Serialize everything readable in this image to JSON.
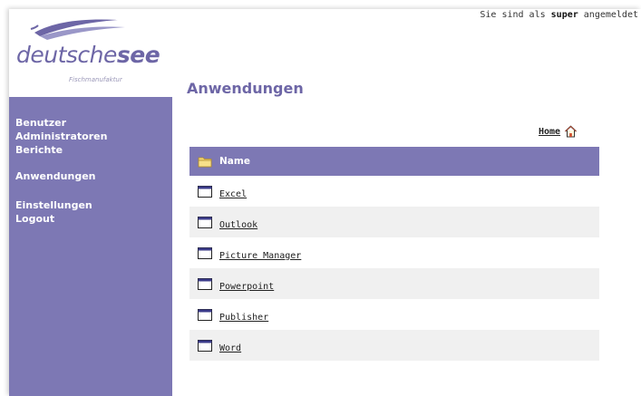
{
  "brand": {
    "name_light": "deutsche",
    "name_bold": "see",
    "tagline": "Fischmanufaktur"
  },
  "header": {
    "login_prefix": "Sie sind als ",
    "login_user": "super",
    "login_suffix": " angemeldet"
  },
  "sidebar": {
    "items": [
      {
        "label": "Benutzer"
      },
      {
        "label": "Administratoren"
      },
      {
        "label": "Berichte"
      },
      {
        "label": "Anwendungen"
      },
      {
        "label": "Einstellungen"
      },
      {
        "label": "Logout"
      }
    ]
  },
  "main": {
    "title": "Anwendungen",
    "home_label": "Home",
    "table": {
      "header": "Name",
      "rows": [
        {
          "name": "Excel"
        },
        {
          "name": "Outlook"
        },
        {
          "name": "Picture Manager"
        },
        {
          "name": "Powerpoint"
        },
        {
          "name": "Publisher"
        },
        {
          "name": "Word"
        }
      ]
    }
  },
  "colors": {
    "accent": "#7d78b4",
    "title": "#6d66a6",
    "row_alt": "#f0f0f0"
  },
  "icons": {
    "header": "folder-icon",
    "row": "window-icon",
    "home": "house-icon"
  }
}
